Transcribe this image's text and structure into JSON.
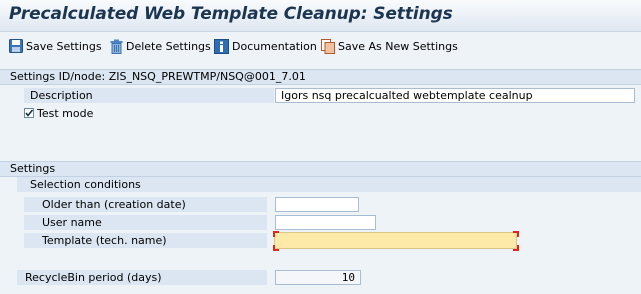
{
  "title": "Precalculated Web Template Cleanup: Settings",
  "toolbar": {
    "save": "Save Settings",
    "delete": "Delete Settings",
    "documentation": "Documentation",
    "save_as_new": "Save As New Settings"
  },
  "settings_id_label": "Settings ID/node: ZIS_NSQ_PREWTMP/NSQ@001_7.01",
  "description": {
    "label": "Description",
    "value": "Igors nsq  precalcualted webtemplate cealnup"
  },
  "test_mode": {
    "label": "Test mode",
    "checked": true
  },
  "settings_section": "Settings",
  "selection_conditions": "Selection conditions",
  "fields": {
    "older_than": {
      "label": "Older than (creation date)",
      "value": ""
    },
    "user_name": {
      "label": "User name",
      "value": ""
    },
    "template": {
      "label": "Template (tech. name)",
      "value": ""
    }
  },
  "recyclebin": {
    "label": "RecycleBin period (days)",
    "value": "10"
  },
  "colors": {
    "background": "#eef3f8",
    "section": "#dbe6f2",
    "required_field": "#fde9a8",
    "title_text": "#1c3652"
  }
}
